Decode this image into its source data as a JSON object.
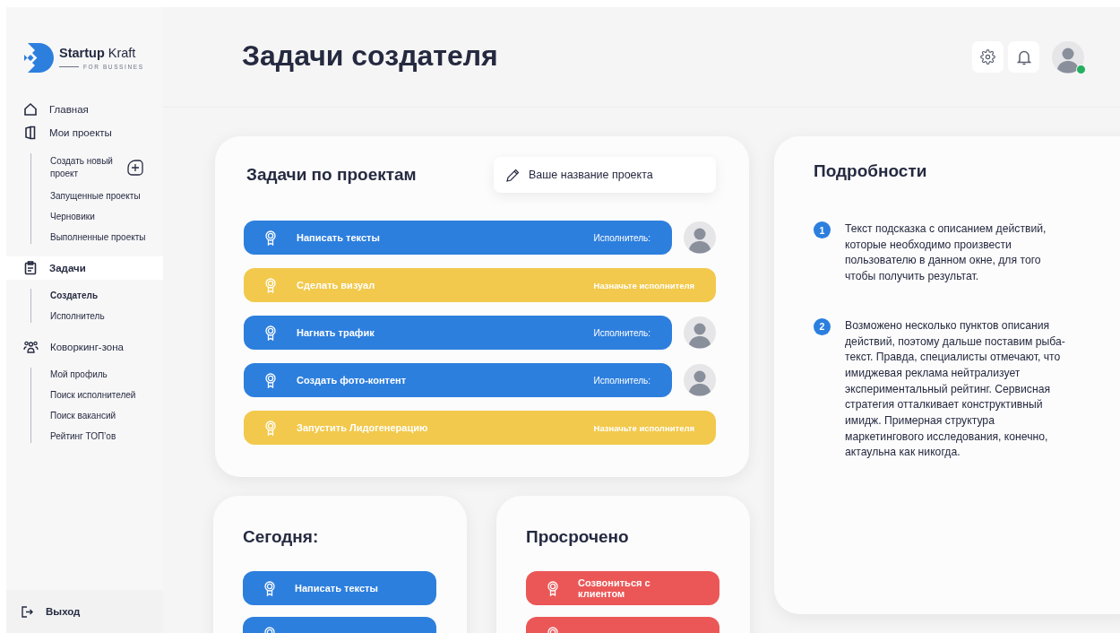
{
  "logo": {
    "name": "Startup",
    "name_suffix": "Kraft",
    "tagline": "FOR BUSSINES"
  },
  "sidebar": {
    "items": [
      {
        "label": "Главная",
        "kind": "home",
        "selected": false
      },
      {
        "label": "Мои проекты",
        "kind": "book",
        "selected": false,
        "children": [
          {
            "label": "Создать новый проект",
            "kind": "create",
            "selected": false
          },
          {
            "label": "Запущенные проекты",
            "kind": "link",
            "selected": false
          },
          {
            "label": "Черновики",
            "kind": "link",
            "selected": false
          },
          {
            "label": "Выполненные проекты",
            "kind": "link",
            "selected": false
          }
        ]
      },
      {
        "label": "Задачи",
        "kind": "tasks",
        "selected": true,
        "children": [
          {
            "label": "Создатель",
            "kind": "link",
            "selected": true
          },
          {
            "label": "Исполнитель",
            "kind": "link",
            "selected": false
          }
        ]
      },
      {
        "label": "Коворкинг-зона",
        "kind": "people",
        "selected": false,
        "children": [
          {
            "label": "Мой профиль",
            "kind": "link",
            "selected": false
          },
          {
            "label": "Поиск исполнителей",
            "kind": "link",
            "selected": false
          },
          {
            "label": "Поиск вакансий",
            "kind": "link",
            "selected": false
          },
          {
            "label": "Рейтинг ТОП’ов",
            "kind": "link",
            "selected": false
          }
        ]
      }
    ],
    "exit": "Выход"
  },
  "header": {
    "title": "Задачи создателя",
    "user": {
      "online": true
    }
  },
  "projects": {
    "title": "Задачи по проектам",
    "field": {
      "placeholder": "Ваше название проекта"
    },
    "tasks": [
      {
        "name": "Написать тексты",
        "kind": "assigned",
        "color": "#2d7fde",
        "assignee_label": "Исполнитель:"
      },
      {
        "name": "Сделать визуал",
        "kind": "unassigned",
        "color": "#f2c94c",
        "action": "Назначьте исполнителя"
      },
      {
        "name": "Нагнать трафик",
        "kind": "assigned",
        "color": "#2d7fde",
        "assignee_label": "Исполнитель:"
      },
      {
        "name": "Создать фото-контент",
        "kind": "assigned",
        "color": "#2d7fde",
        "assignee_label": "Исполнитель:"
      },
      {
        "name": "Запустить Лидогенерацию",
        "kind": "unassigned",
        "color": "#f2c94c",
        "action": "Назначьте исполнителя"
      }
    ]
  },
  "details": {
    "title": "Подробности",
    "steps": [
      {
        "number": "1",
        "text": "Текст подсказка с описанием действий, которые необходимо произвести пользователю в данном окне, для того чтобы получить результат."
      },
      {
        "number": "2",
        "text": "Возможено несколько пунктов описания действий, поэтому дальше поставим рыба-текст. Правда, специалисты отмечают, что имиджевая реклама нейтрализует экспериментальный рейтинг. Сервисная стратегия отталкивает конструктивный имидж. Примерная структура маркетингового исследования, конечно, актаульна как никогда."
      }
    ]
  },
  "today": {
    "title": "Сегодня:",
    "tasks": [
      {
        "name": "Написать тексты",
        "color": "#2d7fde"
      },
      {
        "color": "#2d7fde"
      }
    ]
  },
  "overdue": {
    "title": "Просрочено",
    "tasks": [
      {
        "name": "Созвониться с клиентом",
        "color": "#eb5757"
      },
      {
        "color": "#eb5757"
      }
    ]
  }
}
